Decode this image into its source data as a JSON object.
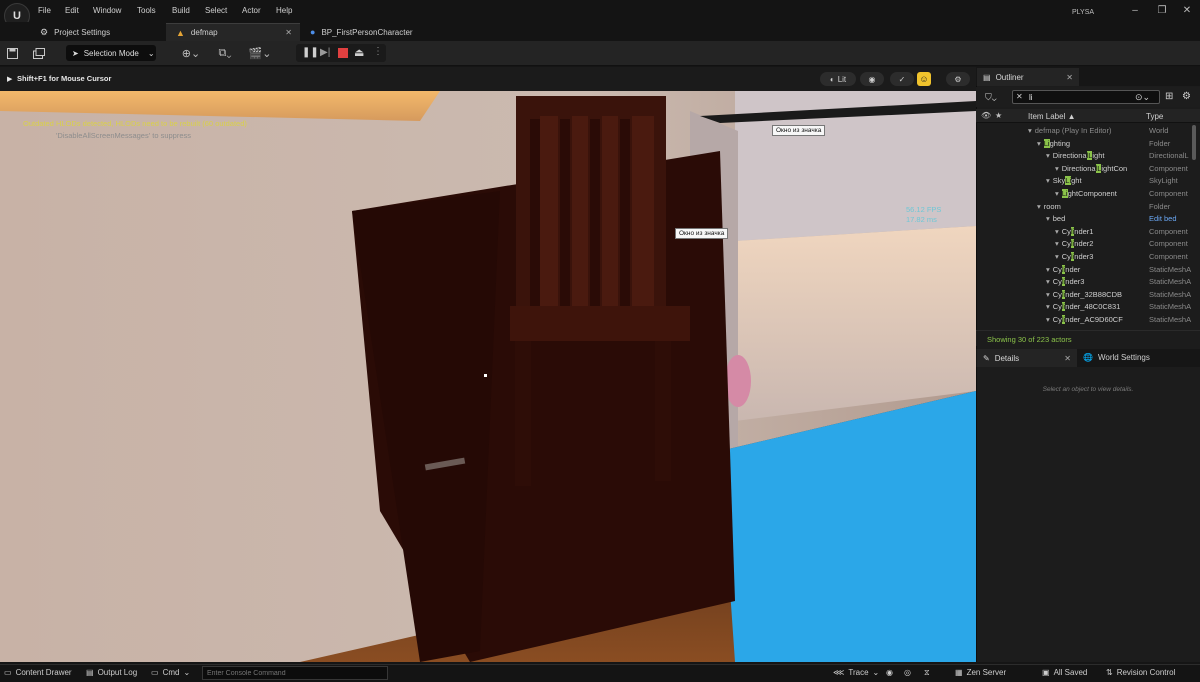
{
  "menu": {
    "logo": "U",
    "items": [
      "File",
      "Edit",
      "Window",
      "Tools",
      "Build",
      "Select",
      "Actor",
      "Help"
    ],
    "project_name": "PLYSA",
    "window_controls": [
      "minimize-icon",
      "restore-icon",
      "close-icon"
    ]
  },
  "tabs": [
    {
      "label": "Project Settings",
      "icon": "gear-icon"
    },
    {
      "label": "defmap",
      "icon": "level-icon",
      "active": true
    },
    {
      "label": "BP_FirstPersonCharacter",
      "icon": "blueprint-icon"
    }
  ],
  "toolbar": {
    "selection_mode_label": "Selection Mode",
    "play_controls": [
      "pause-icon",
      "step-icon",
      "stop-icon",
      "eject-icon",
      "more-icon"
    ]
  },
  "viewport": {
    "hint": "Shift+F1 for Mouse Cursor",
    "view_mode": "Lit",
    "messages": {
      "hlod": "Outdated HLODs detected, HLODs need to be rebuilt (60 outdated)",
      "suppress": "'DisableAllScreenMessages' to suppress"
    },
    "tooltips": [
      "Окно из значка",
      "Окно из значка"
    ],
    "stats": {
      "fps": "56.12 FPS",
      "ms": "17.82 ms"
    }
  },
  "outliner": {
    "tab_label": "Outliner",
    "search_value": "li",
    "columns": {
      "label": "Item Label ▲",
      "type": "Type"
    },
    "rows": [
      {
        "indent": 0,
        "pre": "defmap (Play In Editor)",
        "hl": "",
        "post": "",
        "type": "World",
        "dim": true
      },
      {
        "indent": 1,
        "pre": "",
        "hl": "Li",
        "post": "ghting",
        "type": "Folder"
      },
      {
        "indent": 2,
        "pre": "Directiona",
        "hl": "lL",
        "post": "ight",
        "type": "DirectionalL"
      },
      {
        "indent": 3,
        "pre": "Directiona",
        "hl": "lL",
        "post": "ightCon",
        "type": "Component"
      },
      {
        "indent": 2,
        "pre": "Sky",
        "hl": "Li",
        "post": "ght",
        "type": "SkyLight"
      },
      {
        "indent": 3,
        "pre": "",
        "hl": "Li",
        "post": "ghtComponent",
        "type": "Component"
      },
      {
        "indent": 1,
        "pre": "room",
        "hl": "",
        "post": "",
        "type": "Folder"
      },
      {
        "indent": 2,
        "pre": "bed",
        "hl": "",
        "post": "",
        "type": "Edit bed",
        "link": true
      },
      {
        "indent": 3,
        "pre": "Cy",
        "hl": "li",
        "post": "nder1",
        "type": "Component"
      },
      {
        "indent": 3,
        "pre": "Cy",
        "hl": "li",
        "post": "nder2",
        "type": "Component"
      },
      {
        "indent": 3,
        "pre": "Cy",
        "hl": "li",
        "post": "nder3",
        "type": "Component"
      },
      {
        "indent": 2,
        "pre": "Cy",
        "hl": "li",
        "post": "nder",
        "type": "StaticMeshA"
      },
      {
        "indent": 2,
        "pre": "Cy",
        "hl": "li",
        "post": "nder3",
        "type": "StaticMeshA"
      },
      {
        "indent": 2,
        "pre": "Cy",
        "hl": "li",
        "post": "nder_32B88CDB",
        "type": "StaticMeshA"
      },
      {
        "indent": 2,
        "pre": "Cy",
        "hl": "li",
        "post": "nder_48C0C831",
        "type": "StaticMeshA"
      },
      {
        "indent": 2,
        "pre": "Cy",
        "hl": "li",
        "post": "nder_AC9D60CF",
        "type": "StaticMeshA"
      }
    ],
    "footer": "Showing 30 of 223 actors"
  },
  "details": {
    "tab_label": "Details",
    "world_settings_label": "World Settings",
    "empty_message": "Select an object to view details."
  },
  "statusbar": {
    "content_drawer": "Content Drawer",
    "output_log": "Output Log",
    "cmd": "Cmd",
    "console_placeholder": "Enter Console Command",
    "trace": "Trace",
    "zen_server": "Zen Server",
    "all_saved": "All Saved",
    "revision_control": "Revision Control"
  },
  "colors": {
    "accent": "#8bc34a",
    "play_stop": "#e04040",
    "floor_blue": "#2ba7e8"
  }
}
